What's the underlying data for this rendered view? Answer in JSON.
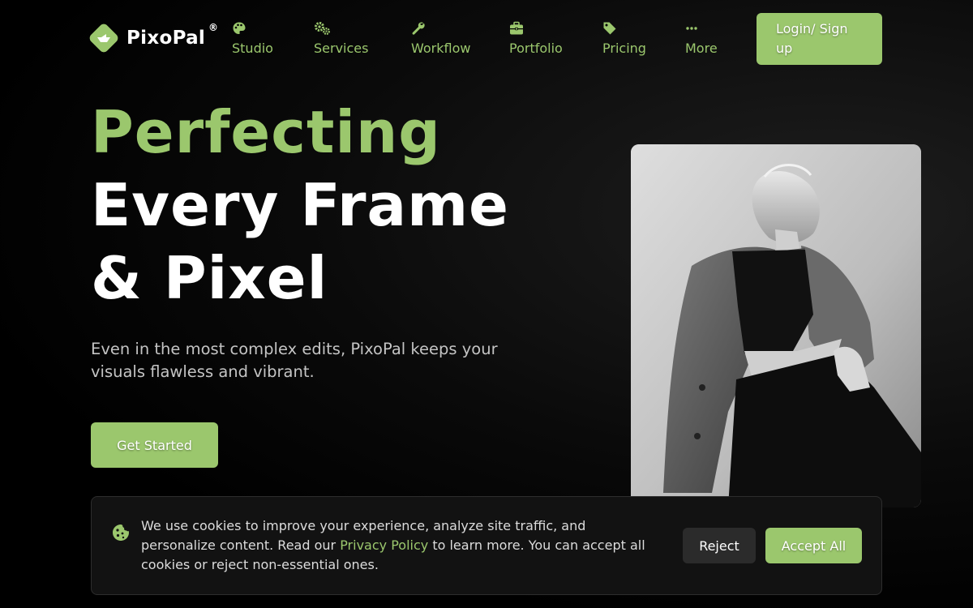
{
  "brand": {
    "name": "PixoPal",
    "reg_mark": "®"
  },
  "nav": {
    "items": [
      {
        "label": "Studio",
        "icon": "palette-icon"
      },
      {
        "label": "Services",
        "icon": "gears-icon"
      },
      {
        "label": "Workflow",
        "icon": "wrench-icon"
      },
      {
        "label": "Portfolio",
        "icon": "briefcase-icon"
      },
      {
        "label": "Pricing",
        "icon": "tag-icon"
      },
      {
        "label": "More",
        "icon": "ellipsis-icon"
      }
    ],
    "login_label": "Login/ Sign up"
  },
  "hero": {
    "title_line1": "Perfecting",
    "title_line2": "Every Frame",
    "title_line3": "& Pixel",
    "subtitle": "Even in the most complex edits, PixoPal keeps your visuals flawless and vibrant.",
    "cta_label": "Get Started"
  },
  "cookie_banner": {
    "text_before": "We use cookies to improve your experience, analyze site traffic, and personalize content. Read our ",
    "link_text": "Privacy Policy",
    "text_after": " to learn more. You can accept all cookies or reject non-essential ones.",
    "reject_label": "Reject",
    "accept_label": "Accept All"
  },
  "colors": {
    "accent": "#9bc76d",
    "background": "#000000",
    "banner_bg": "#121212",
    "reject_bg": "#2b2b2b"
  }
}
